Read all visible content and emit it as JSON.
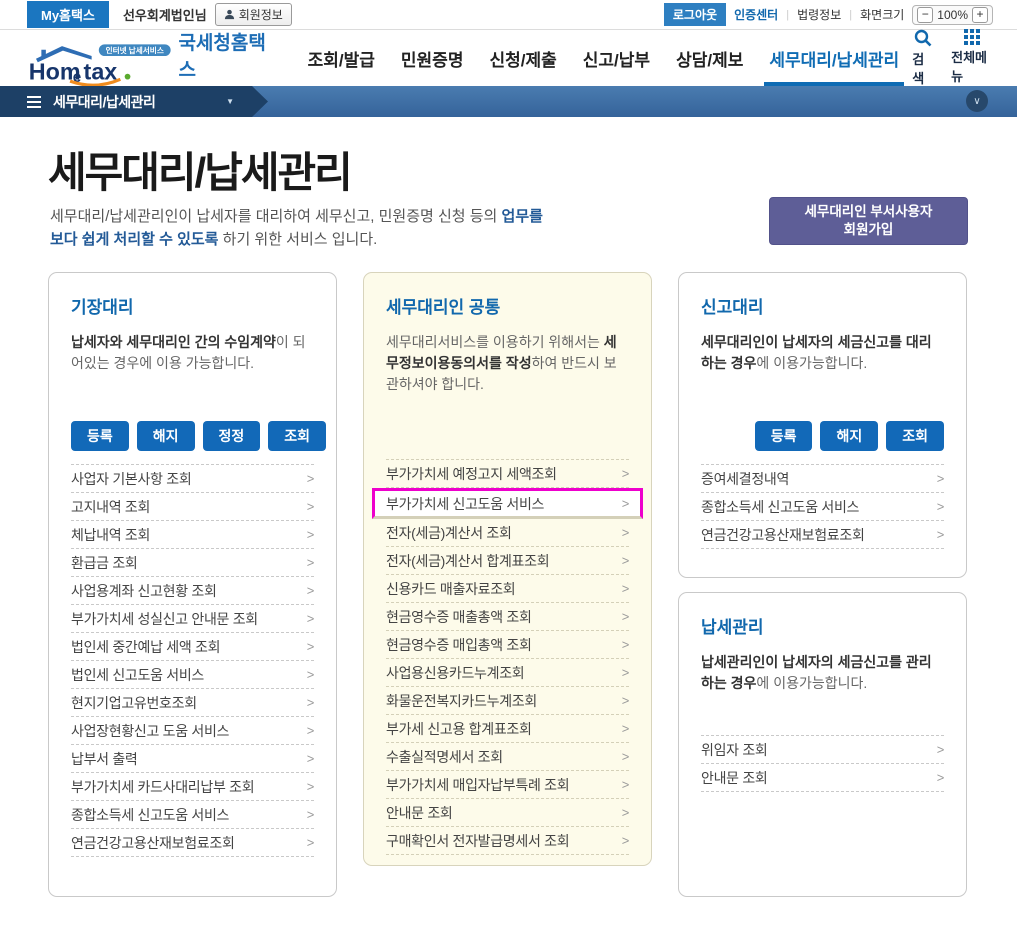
{
  "topbar": {
    "my_hometax": "My홈택스",
    "user_name": "선우회계법인님",
    "member_info": "회원정보",
    "logout": "로그아웃",
    "cert_center": "인증센터",
    "law_info": "법령정보",
    "screen_size": "화면크기",
    "zoom_out": "−",
    "zoom_level": "100%",
    "zoom_in": "+"
  },
  "header": {
    "logo": {
      "brand_hom": "Hom",
      "brand_e": "e",
      "brand_tax": "tax",
      "tagline": "인터넷 납세서비스",
      "service_name": "국세청홈택스"
    },
    "nav": [
      {
        "label": "조회/발급",
        "active": false
      },
      {
        "label": "민원증명",
        "active": false
      },
      {
        "label": "신청/제출",
        "active": false
      },
      {
        "label": "신고/납부",
        "active": false
      },
      {
        "label": "상담/제보",
        "active": false
      },
      {
        "label": "세무대리/납세관리",
        "active": true
      }
    ],
    "search_label": "검색",
    "all_menu_label": "전체메뉴"
  },
  "locbar": {
    "current": "세무대리/납세관리"
  },
  "page": {
    "title": "세무대리/납세관리",
    "desc_l1_normal": "세무대리/납세관리인이 납세자를 대리하여 세무신고, 민원증명 신청 등의 ",
    "desc_l1_bold": "업무를",
    "desc_l2_bold": "보다 쉽게 처리할 수 있도록",
    "desc_l2_normal": " 하기 위한 서비스 입니다.",
    "signup_line1": "세무대리인 부서사용자",
    "signup_line2": "회원가입"
  },
  "cards": {
    "bookkeeping": {
      "title": "기장대리",
      "desc_bold": "납세자와 세무대리인 간의 수임계약",
      "desc_normal": "이 되어있는 경우에 이용 가능합니다.",
      "buttons": [
        {
          "label": "등록"
        },
        {
          "label": "해지"
        },
        {
          "label": "정정"
        },
        {
          "label": "조회"
        }
      ],
      "items": [
        {
          "label": "사업자 기본사항 조회"
        },
        {
          "label": "고지내역 조회"
        },
        {
          "label": "체납내역 조회"
        },
        {
          "label": "환급금 조회"
        },
        {
          "label": "사업용계좌 신고현황 조회"
        },
        {
          "label": "부가가치세 성실신고 안내문 조회"
        },
        {
          "label": "법인세 중간예납 세액 조회"
        },
        {
          "label": "법인세 신고도움 서비스"
        },
        {
          "label": "현지기업고유번호조회"
        },
        {
          "label": "사업장현황신고 도움 서비스"
        },
        {
          "label": "납부서 출력"
        },
        {
          "label": "부가가치세 카드사대리납부 조회"
        },
        {
          "label": "종합소득세 신고도움 서비스"
        },
        {
          "label": "연금건강고용산재보험료조회"
        }
      ]
    },
    "common": {
      "title": "세무대리인 공통",
      "desc_normal1": "세무대리서비스를 이용하기 위해서는 ",
      "desc_bold": "세무정보이용동의서를 작성",
      "desc_normal2": "하여 반드시 보관하셔야 합니다.",
      "items": [
        {
          "label": "부가가치세 예정고지 세액조회"
        },
        {
          "label": "부가가치세 신고도움 서비스",
          "highlighted": true
        },
        {
          "label": "전자(세금)계산서 조회"
        },
        {
          "label": "전자(세금)계산서 합계표조회"
        },
        {
          "label": "신용카드 매출자료조회"
        },
        {
          "label": "현금영수증 매출총액 조회"
        },
        {
          "label": "현금영수증 매입총액 조회"
        },
        {
          "label": "사업용신용카드누계조회"
        },
        {
          "label": "화물운전복지카드누계조회"
        },
        {
          "label": "부가세 신고용 합계표조회"
        },
        {
          "label": "수출실적명세서 조회"
        },
        {
          "label": "부가가치세 매입자납부특례 조회"
        },
        {
          "label": "안내문 조회"
        },
        {
          "label": "구매확인서 전자발급명세서 조회"
        }
      ]
    },
    "filing": {
      "title": "신고대리",
      "desc_bold": "세무대리인이 납세자의 세금신고를 대리하는 경우",
      "desc_normal": "에 이용가능합니다.",
      "buttons": [
        {
          "label": "등록"
        },
        {
          "label": "해지"
        },
        {
          "label": "조회"
        }
      ],
      "items": [
        {
          "label": "증여세결정내역"
        },
        {
          "label": "종합소득세 신고도움 서비스"
        },
        {
          "label": "연금건강고용산재보험료조회"
        }
      ]
    },
    "tax_mgmt": {
      "title": "납세관리",
      "desc_bold": "납세관리인이 납세자의 세금신고를 관리하는 경우",
      "desc_normal": "에 이용가능합니다.",
      "items": [
        {
          "label": "위임자 조회"
        },
        {
          "label": "안내문 조회"
        }
      ]
    }
  },
  "colors": {
    "accent_blue": "#1168ad",
    "button_blue": "#1269b8",
    "highlight_magenta": "#ee00cc",
    "signup_purple": "#5e5e97",
    "locbar_dark": "#1d4066",
    "locbar_light": "#3f6fa5",
    "yellow_card_bg": "#fdfbea"
  }
}
